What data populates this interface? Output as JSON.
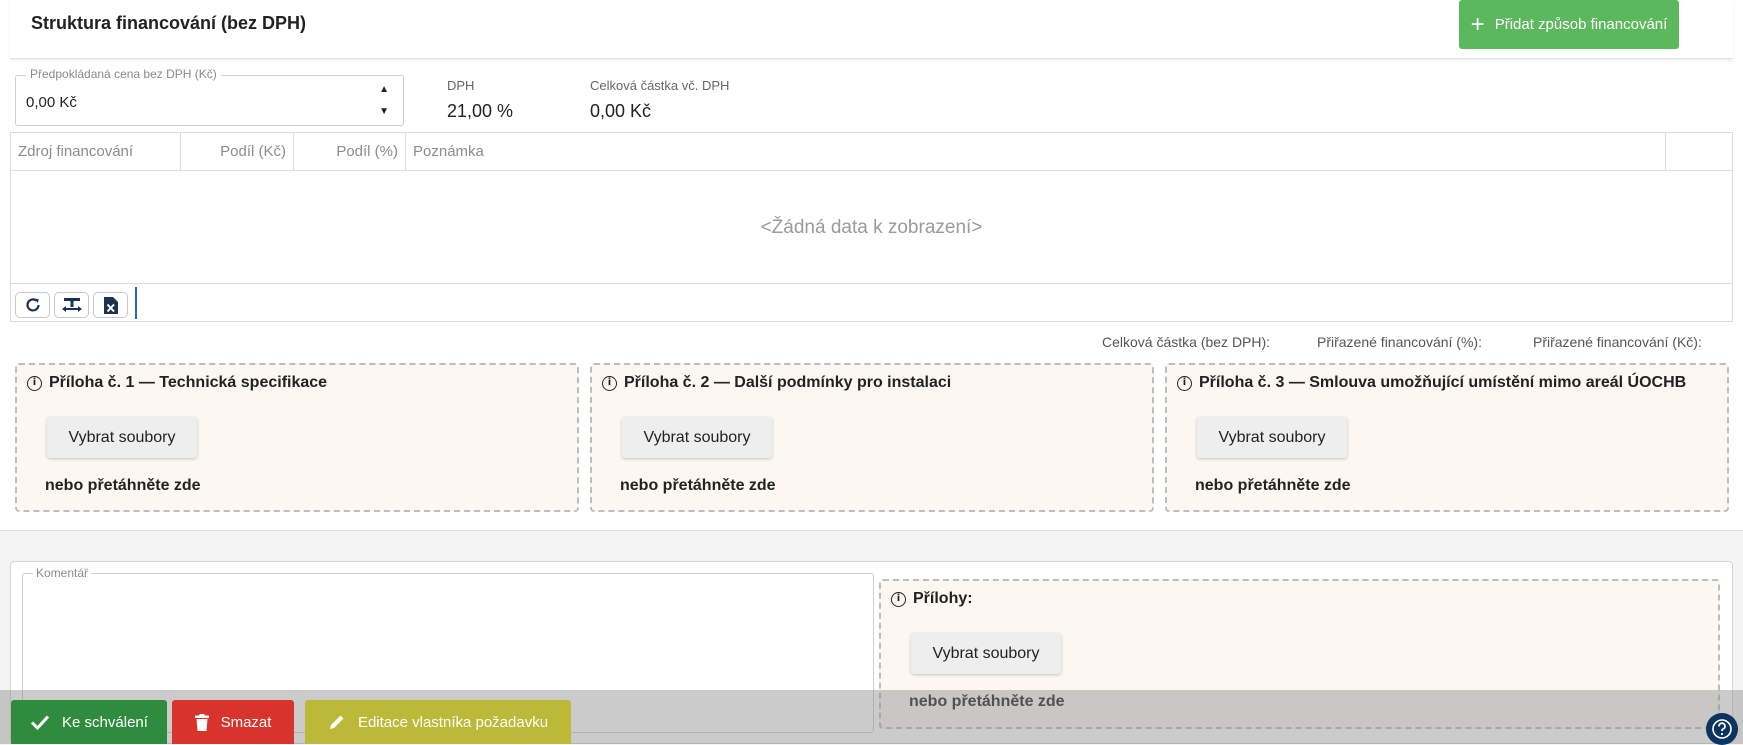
{
  "header": {
    "title": "Struktura financování (bez DPH)",
    "add_button_label": "Přidat způsob financování"
  },
  "price": {
    "label": "Předpokládaná cena bez DPH (Kč)",
    "value": "0,00 Kč"
  },
  "vat": {
    "label": "DPH",
    "value": "21,00 %"
  },
  "total_with_vat": {
    "label": "Celková částka vč. DPH",
    "value": "0,00 Kč"
  },
  "grid": {
    "columns": [
      "Zdroj financování",
      "Podíl (Kč)",
      "Podíl (%)",
      "Poznámka",
      ""
    ],
    "empty_message": "<Žádná data k zobrazení>",
    "toolbar": [
      "refresh-icon",
      "column-fit-icon",
      "excel-export-icon"
    ]
  },
  "totals": {
    "total_excl_vat": "Celková částka (bez DPH):",
    "assigned_pct": "Přiřazené financování (%):",
    "assigned_czk": "Přiřazené financování (Kč):"
  },
  "attachments": [
    {
      "title": "Příloha č. 1 — Technická specifikace",
      "button": "Vybrat soubory",
      "drop": "nebo přetáhněte zde"
    },
    {
      "title": "Příloha č. 2 — Další podmínky pro instalaci",
      "button": "Vybrat soubory",
      "drop": "nebo přetáhněte zde"
    },
    {
      "title": "Příloha č. 3 — Smlouva umožňující umístění mimo areál ÚOCHB",
      "button": "Vybrat soubory",
      "drop": "nebo přetáhněte zde"
    }
  ],
  "comment": {
    "label": "Komentář",
    "value": ""
  },
  "general_attachments": {
    "title": "Přílohy:",
    "button": "Vybrat soubory",
    "drop": "nebo přetáhněte zde"
  },
  "actions": {
    "approve": "Ke schválení",
    "delete": "Smazat",
    "edit_owner": "Editace vlastníka požadavku"
  },
  "colors": {
    "primary_green": "#5cb85c",
    "approve_green": "#2f8c3e",
    "delete_red": "#d9342b",
    "edit_olive": "#bcb838",
    "help_navy": "#0d3461",
    "attachment_bg": "#fcf8f1"
  }
}
